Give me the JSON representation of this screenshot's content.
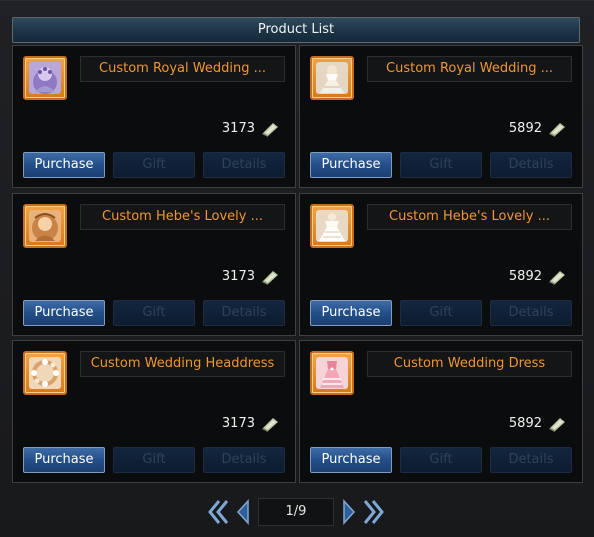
{
  "window": {
    "title": "Product List"
  },
  "buttons": {
    "purchase": "Purchase",
    "gift": "Gift",
    "details": "Details"
  },
  "products": [
    {
      "name": "Custom Royal Wedding ...",
      "price": "3173",
      "icon": "wedding-headdress-icon"
    },
    {
      "name": "Custom Royal Wedding ...",
      "price": "5892",
      "icon": "wedding-dress-icon"
    },
    {
      "name": "Custom Hebe's Lovely ...",
      "price": "3173",
      "icon": "hebe-headdress-icon"
    },
    {
      "name": "Custom Hebe's Lovely ...",
      "price": "5892",
      "icon": "hebe-dress-icon"
    },
    {
      "name": "Custom Wedding Headdress",
      "price": "3173",
      "icon": "flower-headdress-icon"
    },
    {
      "name": "Custom Wedding Dress",
      "price": "5892",
      "icon": "pink-wedding-dress-icon"
    }
  ],
  "pagination": {
    "page": "1/9"
  },
  "colors": {
    "accent": "#f0962d",
    "button_blue": "#234f89",
    "title_bar": "#1b3344"
  }
}
